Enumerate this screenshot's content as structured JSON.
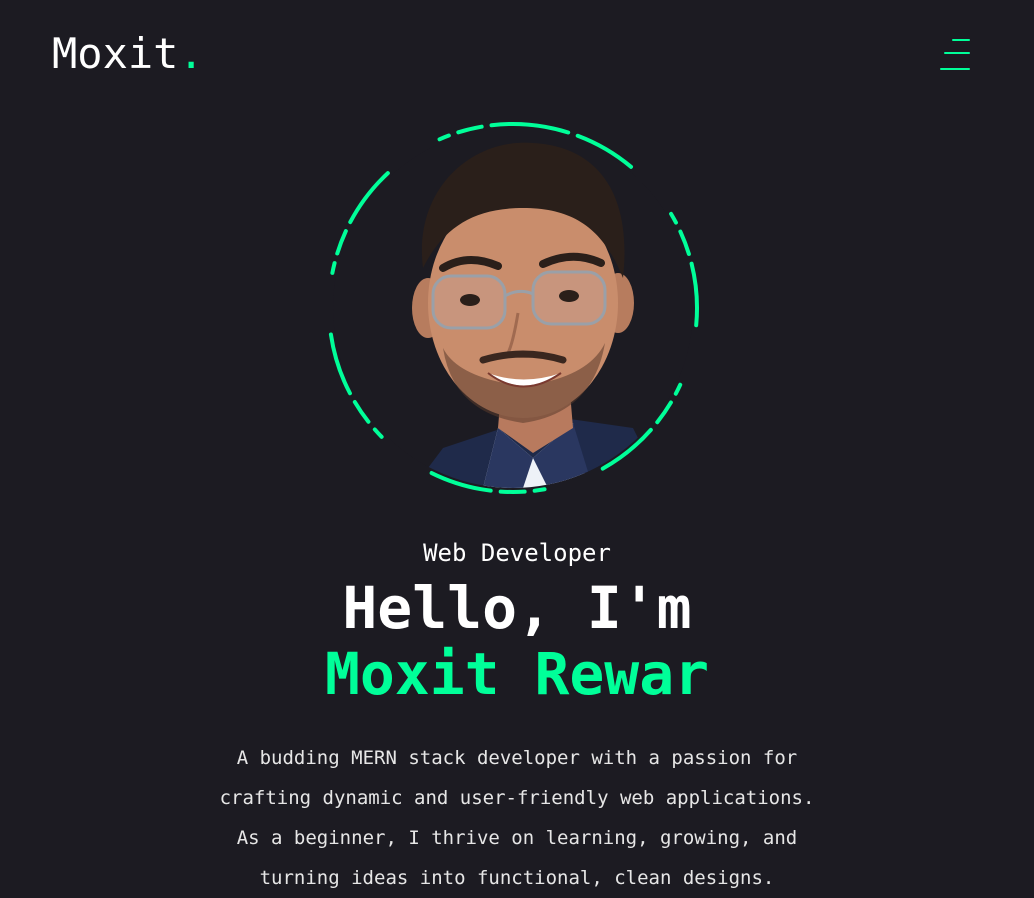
{
  "header": {
    "logo_text": "Moxit",
    "logo_dot": ".",
    "menu_icon": "hamburger-menu-icon"
  },
  "hero": {
    "photo_alt": "Portrait photo",
    "role": "Web Developer",
    "greeting": "Hello, I'm",
    "name": "Moxit Rewar",
    "bio_lines": [
      "A budding MERN stack developer with a passion for",
      "crafting dynamic and user-friendly web applications.",
      "As a beginner, I thrive on learning, growing, and",
      "turning ideas into functional, clean designs."
    ]
  },
  "colors": {
    "background": "#1c1b22",
    "accent": "#00ff99",
    "text": "#ffffff",
    "body_text": "#e6e6e6"
  }
}
